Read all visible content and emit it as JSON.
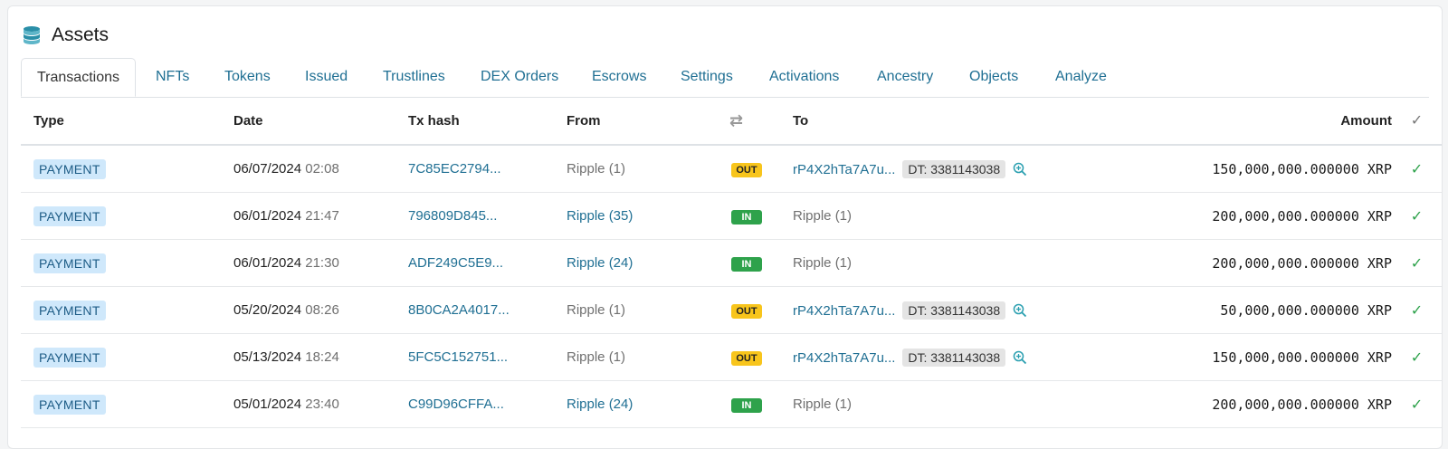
{
  "header": {
    "title": "Assets",
    "icon": "database-icon"
  },
  "tabs": [
    {
      "label": "Transactions",
      "active": true
    },
    {
      "label": "NFTs"
    },
    {
      "label": "Tokens"
    },
    {
      "label": "Issued"
    },
    {
      "label": "Trustlines"
    },
    {
      "label": "DEX Orders"
    },
    {
      "label": "Escrows"
    },
    {
      "label": "Settings"
    },
    {
      "label": "Activations"
    },
    {
      "label": "Ancestry"
    },
    {
      "label": "Objects"
    },
    {
      "label": "Analyze"
    }
  ],
  "table": {
    "columns": {
      "type": "Type",
      "date": "Date",
      "hash": "Tx hash",
      "from": "From",
      "direction": "⇄",
      "to": "To",
      "amount": "Amount",
      "status": "✓"
    },
    "rows": [
      {
        "type": "PAYMENT",
        "date": "06/07/2024",
        "time": "02:08",
        "hash": "7C85EC2794...",
        "from": "Ripple (1)",
        "from_link": false,
        "dir": "OUT",
        "to": "rP4X2hTa7A7u...",
        "to_link": true,
        "dt": "DT: 3381143038",
        "amount": "150,000,000.000000 XRP",
        "status": "✓"
      },
      {
        "type": "PAYMENT",
        "date": "06/01/2024",
        "time": "21:47",
        "hash": "796809D845...",
        "from": "Ripple (35)",
        "from_link": true,
        "dir": "IN",
        "to": "Ripple (1)",
        "to_link": false,
        "dt": "",
        "amount": "200,000,000.000000 XRP",
        "status": "✓"
      },
      {
        "type": "PAYMENT",
        "date": "06/01/2024",
        "time": "21:30",
        "hash": "ADF249C5E9...",
        "from": "Ripple (24)",
        "from_link": true,
        "dir": "IN",
        "to": "Ripple (1)",
        "to_link": false,
        "dt": "",
        "amount": "200,000,000.000000 XRP",
        "status": "✓"
      },
      {
        "type": "PAYMENT",
        "date": "05/20/2024",
        "time": "08:26",
        "hash": "8B0CA2A4017...",
        "from": "Ripple (1)",
        "from_link": false,
        "dir": "OUT",
        "to": "rP4X2hTa7A7u...",
        "to_link": true,
        "dt": "DT: 3381143038",
        "amount": "50,000,000.000000 XRP",
        "status": "✓"
      },
      {
        "type": "PAYMENT",
        "date": "05/13/2024",
        "time": "18:24",
        "hash": "5FC5C152751...",
        "from": "Ripple (1)",
        "from_link": false,
        "dir": "OUT",
        "to": "rP4X2hTa7A7u...",
        "to_link": true,
        "dt": "DT: 3381143038",
        "amount": "150,000,000.000000 XRP",
        "status": "✓"
      },
      {
        "type": "PAYMENT",
        "date": "05/01/2024",
        "time": "23:40",
        "hash": "C99D96CFFA...",
        "from": "Ripple (24)",
        "from_link": true,
        "dir": "IN",
        "to": "Ripple (1)",
        "to_link": false,
        "dt": "",
        "amount": "200,000,000.000000 XRP",
        "status": "✓"
      }
    ]
  },
  "colors": {
    "link": "#1f6f93",
    "out_badge": "#f8c51c",
    "in_badge": "#2ea24b",
    "type_badge": "#cfe8fb",
    "check": "#2ea24b"
  }
}
